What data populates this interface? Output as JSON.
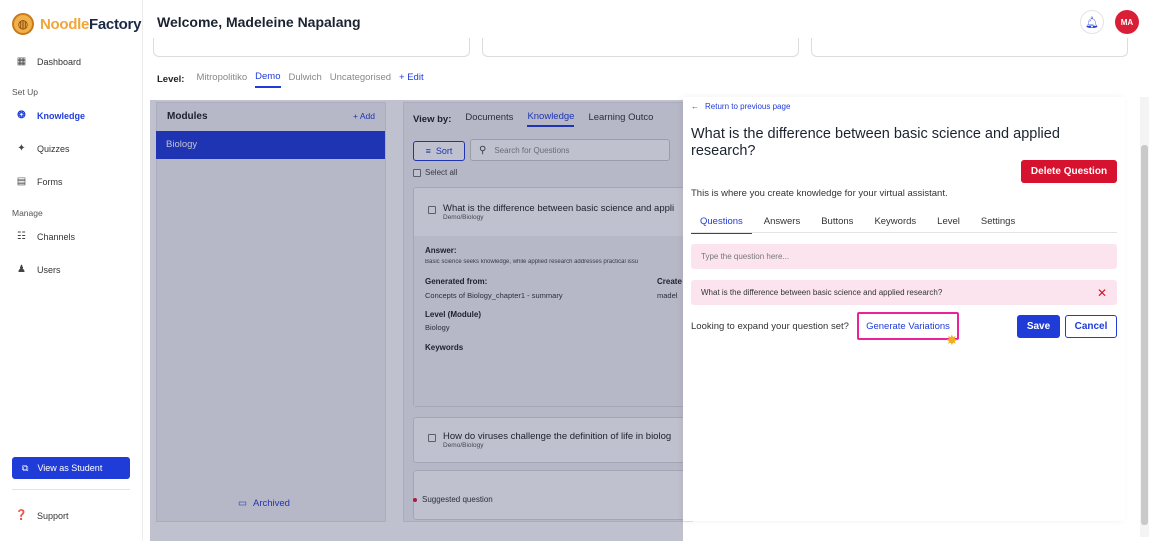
{
  "app": {
    "logo_noodle": "Noodle",
    "logo_factory": "Factory"
  },
  "sidebar": {
    "dashboard": "Dashboard",
    "setup_label": "Set Up",
    "knowledge": "Knowledge",
    "quizzes": "Quizzes",
    "forms": "Forms",
    "manage_label": "Manage",
    "channels": "Channels",
    "users": "Users",
    "view_as_student": "View as Student",
    "support": "Support"
  },
  "header": {
    "welcome": "Welcome, Madeleine Napalang",
    "avatar_initials": "MA"
  },
  "level": {
    "label": "Level:",
    "items": [
      "Mitropolitiko",
      "Demo",
      "Dulwich",
      "Uncategorised"
    ],
    "active": "Demo",
    "edit": "+ Edit"
  },
  "modules": {
    "title": "Modules",
    "add": "+ Add",
    "items": [
      "Biology"
    ],
    "archived": "Archived"
  },
  "knowledge": {
    "view_by": "View by:",
    "tabs": [
      "Documents",
      "Knowledge",
      "Learning Outco"
    ],
    "active_tab": "Knowledge",
    "sort": "Sort",
    "search_placeholder": "Search for Questions",
    "select_all": "Select all",
    "cards": [
      {
        "title": "What is the difference between basic science and appli",
        "path": "Demo/Biology",
        "answer_label": "Answer:",
        "answer": "Basic science seeks knowledge, while applied research addresses practical issu",
        "generated_label": "Generated from:",
        "generated": "Concepts of Biology_chapter1 - summary",
        "created_label": "Create",
        "created": "madel",
        "level_label": "Level (Module)",
        "level": "Biology",
        "keywords_label": "Keywords"
      },
      {
        "title": "How do viruses challenge the definition of life in biolog",
        "path": "Demo/Biology"
      }
    ],
    "suggested": "Suggested question"
  },
  "drawer": {
    "return": "Return to previous page",
    "title": "What is the difference between basic science and applied research?",
    "delete": "Delete Question",
    "description": "This is where you create knowledge for your virtual assistant.",
    "tabs": [
      "Questions",
      "Answers",
      "Buttons",
      "Keywords",
      "Level",
      "Settings"
    ],
    "active_tab": "Questions",
    "input_placeholder": "Type the question here...",
    "question": "What is the difference between basic science and applied research?",
    "expand_prompt": "Looking to expand your question set?",
    "generate": "Generate Variations",
    "save": "Save",
    "cancel": "Cancel"
  },
  "colors": {
    "accent": "#1f3cd8",
    "danger": "#d6122f",
    "highlight": "#e8239b",
    "pink_row": "#fce4ee"
  }
}
